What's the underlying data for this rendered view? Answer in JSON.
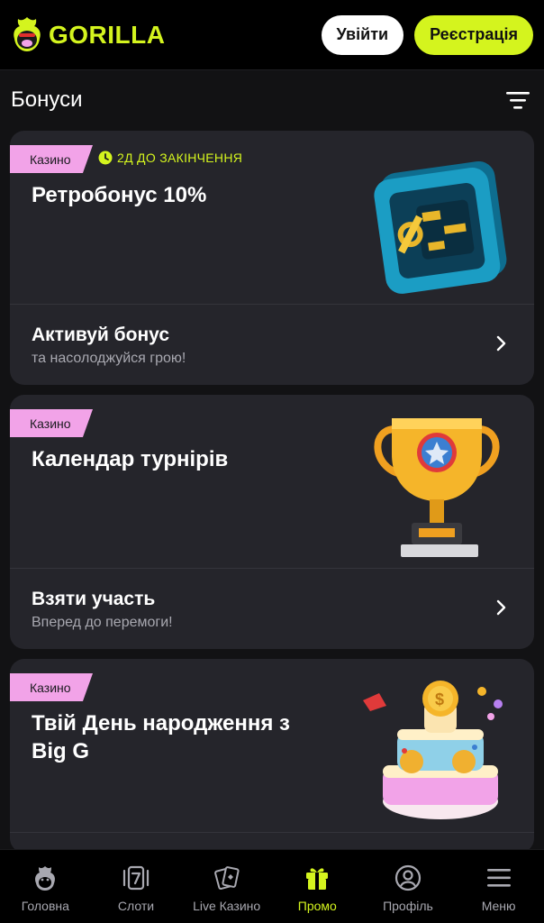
{
  "brand": {
    "name": "GORILLA",
    "accent": "#d4f41e",
    "pink": "#f2a3e8"
  },
  "header": {
    "login_label": "Увійти",
    "register_label": "Реєстрація"
  },
  "section": {
    "title": "Бонуси"
  },
  "cards": [
    {
      "tag": "Казино",
      "expiry": "2Д ДО ЗАКІНЧЕННЯ",
      "title": "Ретробонус 10%",
      "action_title": "Активуй бонус",
      "action_sub": "та насолоджуйся грою!",
      "art": "safe-illustration"
    },
    {
      "tag": "Казино",
      "title": "Календар турнірів",
      "action_title": "Взяти участь",
      "action_sub": "Вперед до перемоги!",
      "art": "trophy-illustration"
    },
    {
      "tag": "Казино",
      "title": "Твій День народження з Big G",
      "art": "birthday-cake-illustration"
    }
  ],
  "nav": [
    {
      "label": "Головна",
      "icon": "gorilla-home-icon"
    },
    {
      "label": "Слоти",
      "icon": "slot-seven-icon"
    },
    {
      "label": "Live Казино",
      "icon": "cards-icon"
    },
    {
      "label": "Промо",
      "icon": "gift-icon",
      "active": true
    },
    {
      "label": "Профіль",
      "icon": "user-circle-icon"
    },
    {
      "label": "Меню",
      "icon": "hamburger-menu-icon"
    }
  ]
}
